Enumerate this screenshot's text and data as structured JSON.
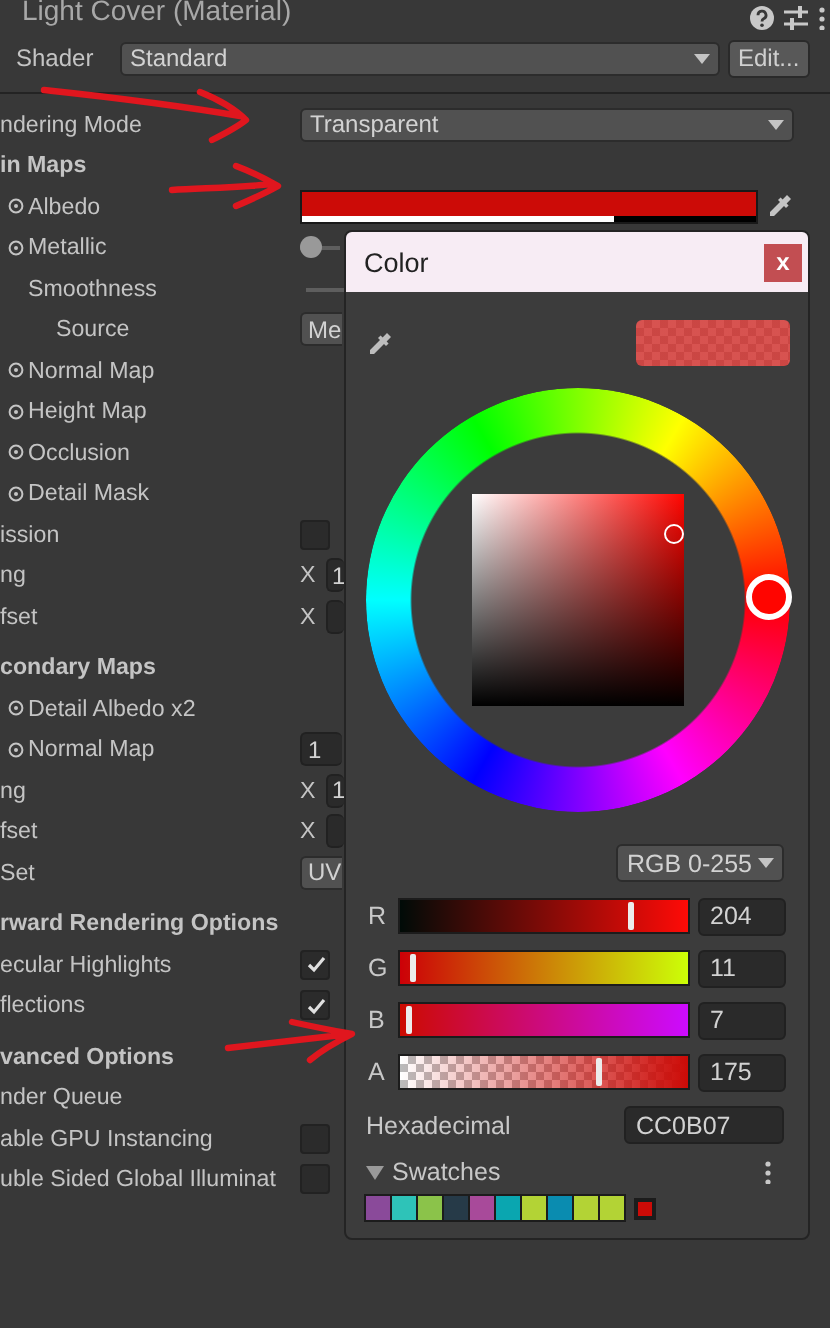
{
  "header": {
    "title": "Light Cover (Material)"
  },
  "shader": {
    "label": "Shader",
    "value": "Standard",
    "edit_button": "Edit..."
  },
  "properties": [
    {
      "kind": "dropdown",
      "label": "ndering Mode",
      "value": "Transparent"
    },
    {
      "kind": "section",
      "label": "in Maps"
    },
    {
      "kind": "color",
      "label": "Albedo",
      "texture_slot": true,
      "color": "#cc0b07",
      "level": 0.686
    },
    {
      "kind": "slider",
      "label": "Metallic",
      "texture_slot": true,
      "level": 0,
      "children": [
        {
          "kind": "slider",
          "label": "Smoothness",
          "children": [
            {
              "kind": "dropdown",
              "label": "Source",
              "value": "Me"
            }
          ]
        }
      ]
    },
    {
      "kind": "texture",
      "label": "Normal Map",
      "texture_slot": true
    },
    {
      "kind": "texture",
      "label": "Height Map",
      "texture_slot": true
    },
    {
      "kind": "texture",
      "label": "Occlusion",
      "texture_slot": true
    },
    {
      "kind": "texture",
      "label": "Detail Mask",
      "texture_slot": true
    },
    {
      "kind": "checkbox",
      "label": "ission",
      "checked": false
    },
    {
      "kind": "vector",
      "label": "ng",
      "axis": "X",
      "value": "1"
    },
    {
      "kind": "vector",
      "label": "fset",
      "axis": "X"
    },
    {
      "kind": "section",
      "label": "condary Maps"
    },
    {
      "kind": "texture",
      "label": "Detail Albedo x2",
      "texture_slot": true
    },
    {
      "kind": "field",
      "label": "Normal Map",
      "texture_slot": true,
      "value": "1"
    },
    {
      "kind": "vector",
      "label": "ng",
      "axis": "X",
      "value": "1"
    },
    {
      "kind": "vector",
      "label": "fset",
      "axis": "X"
    },
    {
      "kind": "dropdown",
      "label": "Set",
      "value": "UV"
    },
    {
      "kind": "section",
      "label": "rward Rendering Options"
    },
    {
      "kind": "checkbox",
      "label": "ecular Highlights",
      "checked": true
    },
    {
      "kind": "checkbox",
      "label": "flections",
      "checked": true
    },
    {
      "kind": "section",
      "label": "vanced Options"
    },
    {
      "kind": "texture",
      "label": "nder Queue"
    },
    {
      "kind": "checkbox",
      "label": "able GPU Instancing",
      "checked": false
    },
    {
      "kind": "checkbox",
      "label": "uble Sided Global Illuminat",
      "checked": false
    }
  ],
  "color_picker": {
    "title": "Color",
    "close": "x",
    "mode": "RGB 0-255",
    "channels": [
      {
        "label": "R",
        "value": "204",
        "level": 0.8
      },
      {
        "label": "G",
        "value": "11",
        "level": 0.043
      },
      {
        "label": "B",
        "value": "7",
        "level": 0.027
      },
      {
        "label": "A",
        "value": "175",
        "level": 0.686
      }
    ],
    "hex_label": "Hexadecimal",
    "hex": "CC0B07",
    "swatches_label": "Swatches",
    "swatches": [
      {
        "color": "#8a4a9a"
      },
      {
        "color": "#2ec3b8"
      },
      {
        "color": "#8bc34a"
      },
      {
        "color": "#263a48"
      },
      {
        "color": "#a84a9a"
      },
      {
        "color": "#0aa6b0"
      },
      {
        "color": "#b3d335"
      },
      {
        "color": "#0a8cb0"
      },
      {
        "color": "#b3d335"
      },
      {
        "color": "#b3d335"
      }
    ],
    "new_swatch": {
      "color": "#cc0b07"
    }
  },
  "annotations": [
    {
      "kind": "arrow"
    },
    {
      "kind": "arrow"
    },
    {
      "kind": "arrow"
    }
  ]
}
